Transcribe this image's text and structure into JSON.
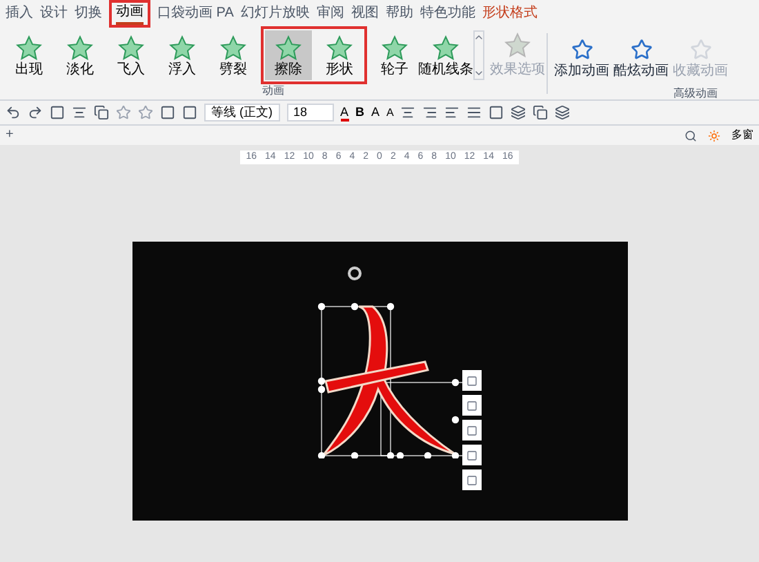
{
  "tabs": [
    {
      "label": "插入",
      "selected": false,
      "kind": "normal"
    },
    {
      "label": "设计",
      "selected": false,
      "kind": "normal"
    },
    {
      "label": "切换",
      "selected": false,
      "kind": "normal"
    },
    {
      "label": "动画",
      "selected": true,
      "kind": "normal",
      "highlighted": true
    },
    {
      "label": "口袋动画 PA",
      "selected": false,
      "kind": "normal"
    },
    {
      "label": "幻灯片放映",
      "selected": false,
      "kind": "normal"
    },
    {
      "label": "审阅",
      "selected": false,
      "kind": "normal"
    },
    {
      "label": "视图",
      "selected": false,
      "kind": "normal"
    },
    {
      "label": "帮助",
      "selected": false,
      "kind": "normal"
    },
    {
      "label": "特色功能",
      "selected": false,
      "kind": "normal"
    },
    {
      "label": "形状格式",
      "selected": false,
      "kind": "contextual"
    }
  ],
  "effects": [
    {
      "label": "出现",
      "selected": false
    },
    {
      "label": "淡化",
      "selected": false
    },
    {
      "label": "飞入",
      "selected": false
    },
    {
      "label": "浮入",
      "selected": false
    },
    {
      "label": "劈裂",
      "selected": false
    },
    {
      "label": "擦除",
      "selected": true,
      "highlighted": true
    },
    {
      "label": "形状",
      "selected": false,
      "highlighted": true
    },
    {
      "label": "轮子",
      "selected": false
    },
    {
      "label": "随机线条",
      "selected": false
    }
  ],
  "effect_options": {
    "label": "效果选项",
    "disabled": true
  },
  "animation_group_label": "动画",
  "advanced": [
    {
      "label": "添加动画",
      "disabled": false
    },
    {
      "label": "酷炫动画",
      "disabled": false
    },
    {
      "label": "收藏动画",
      "disabled": true
    }
  ],
  "advanced_group_label": "高级动画",
  "toolbar": {
    "font_name": "等线 (正文)",
    "font_size": "18",
    "font_color": "A",
    "bold": "B",
    "grow": "A",
    "shrink": "A"
  },
  "window_button": "多窗",
  "add_tab": "+",
  "ruler": [
    "16",
    "14",
    "12",
    "10",
    "8",
    "6",
    "4",
    "2",
    "0",
    "2",
    "4",
    "6",
    "8",
    "10",
    "12",
    "14",
    "16"
  ]
}
